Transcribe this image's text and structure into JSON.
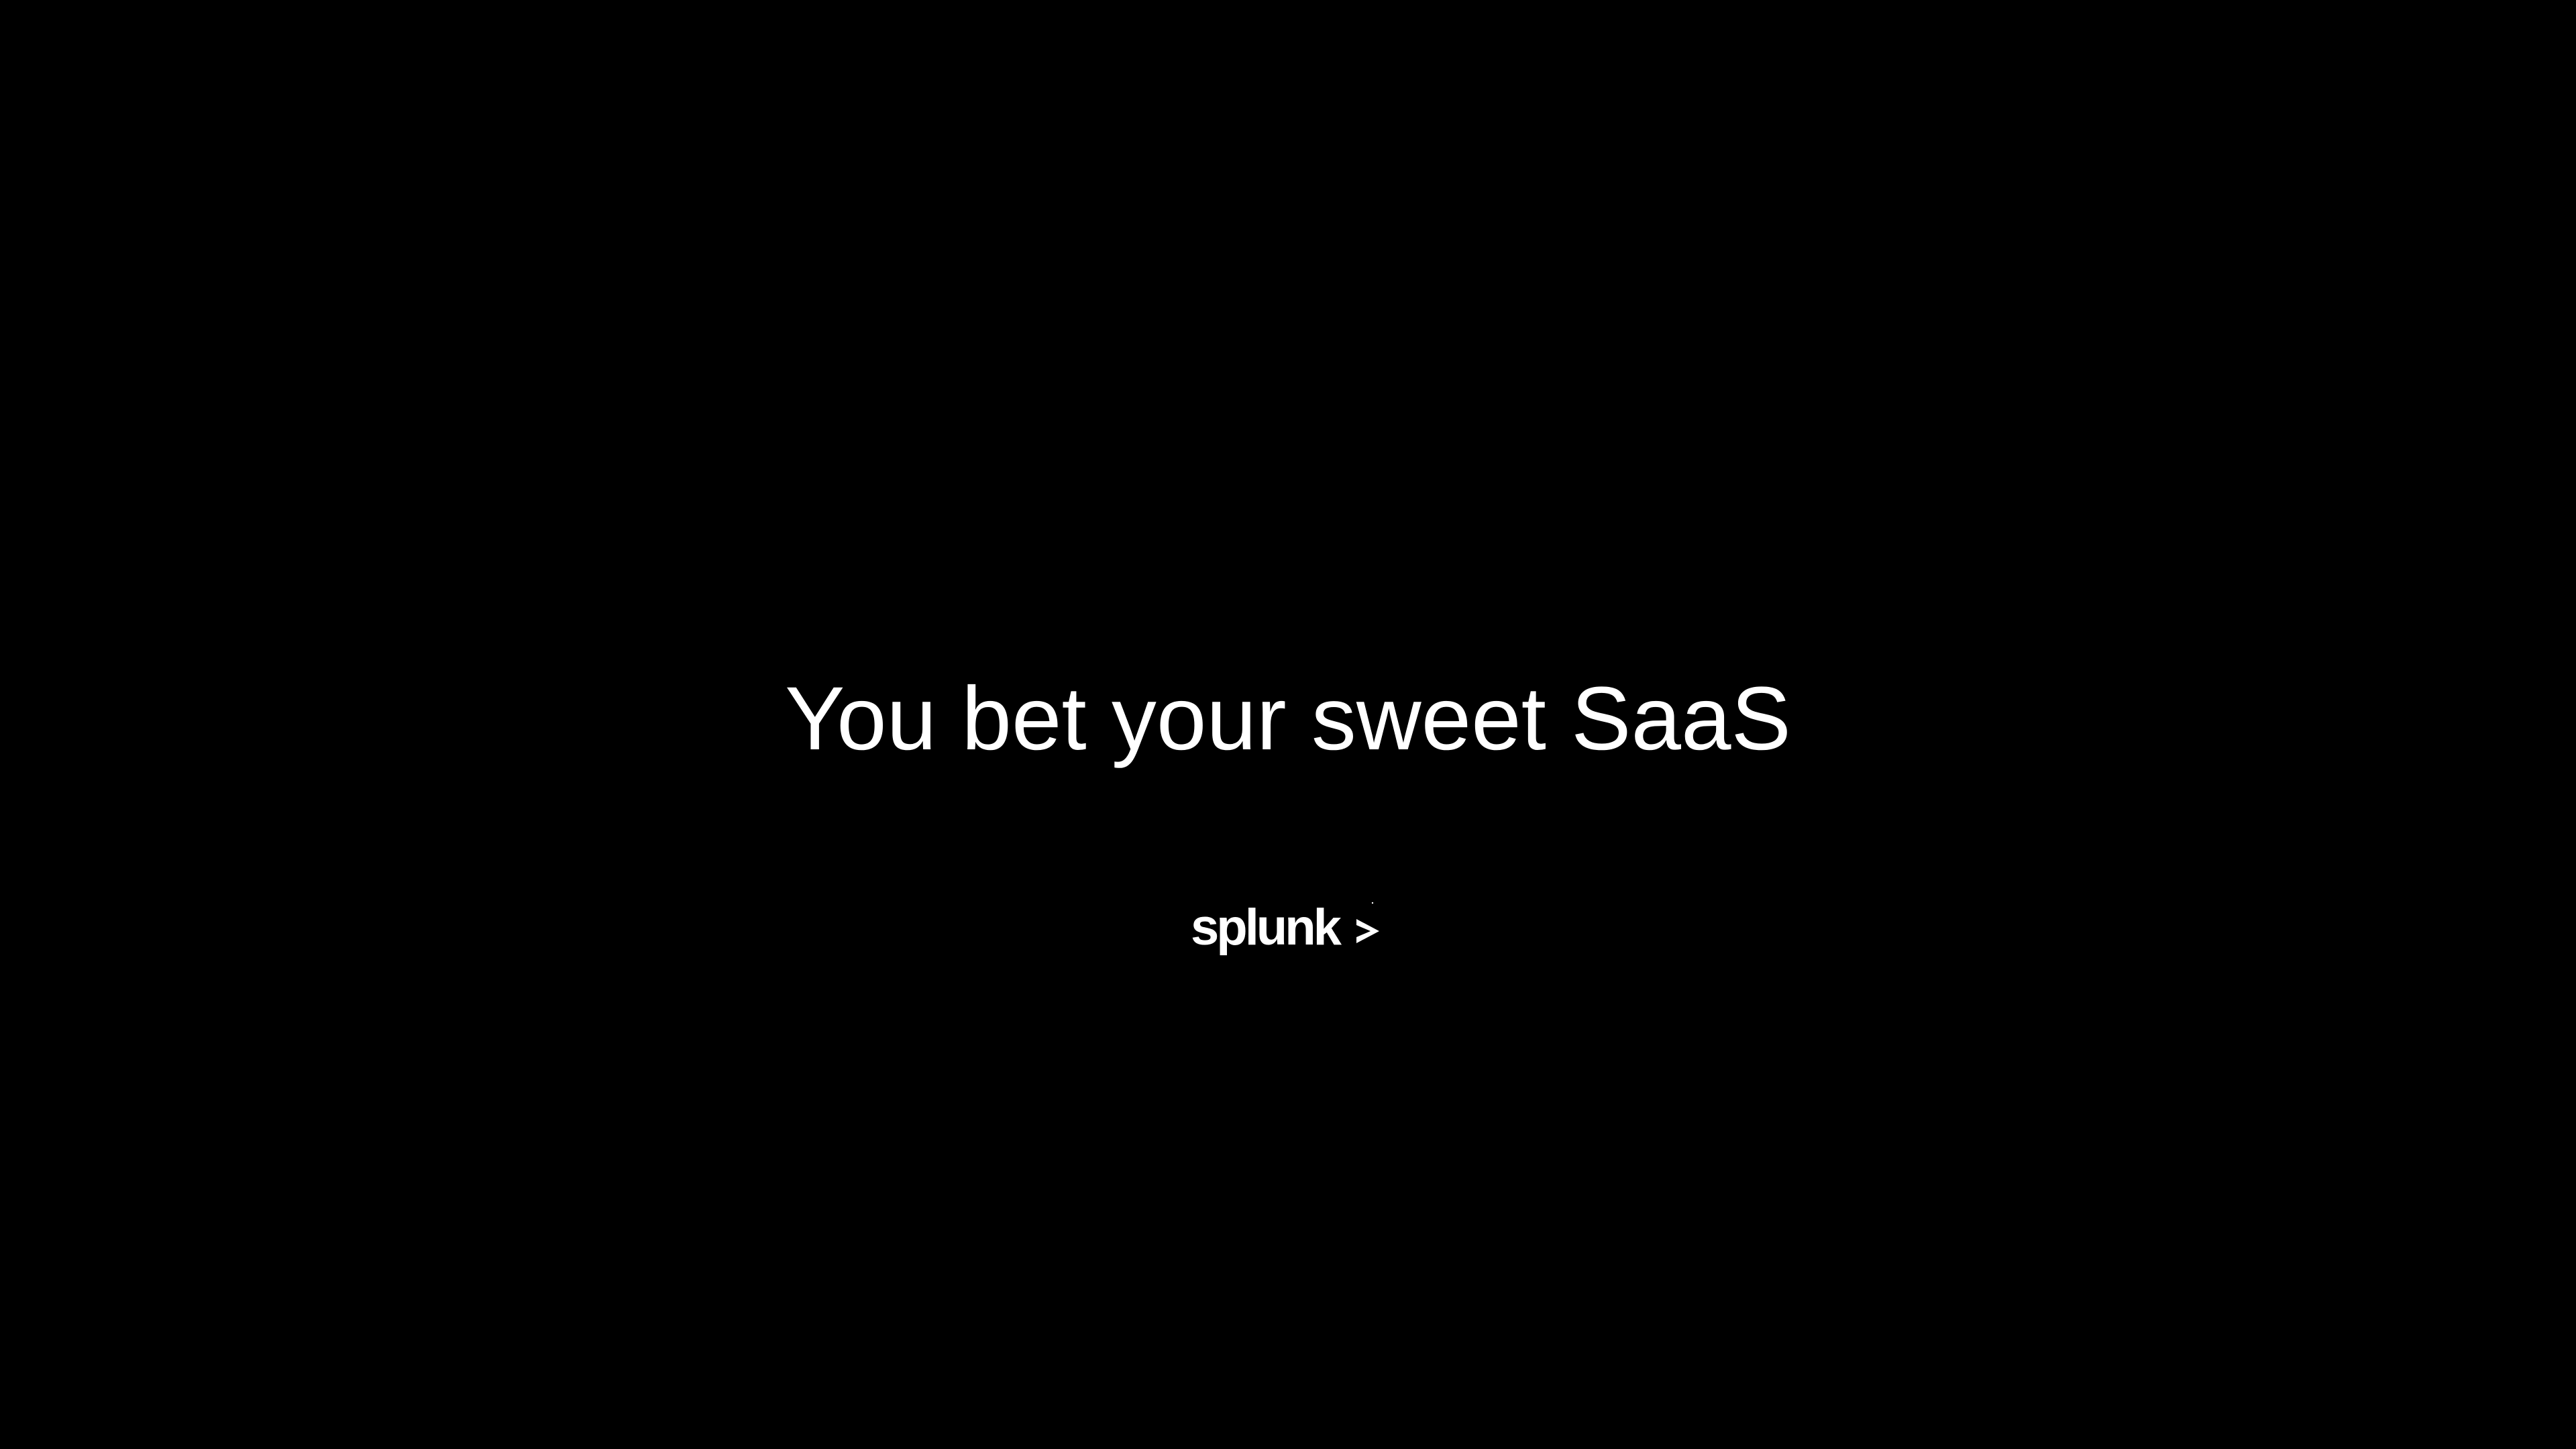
{
  "slide": {
    "headline": "You bet your sweet SaaS",
    "background_color": "#000000",
    "text_color": "#ffffff"
  },
  "logo": {
    "wordmark": "splunk>",
    "icon": "splunk-logo"
  }
}
